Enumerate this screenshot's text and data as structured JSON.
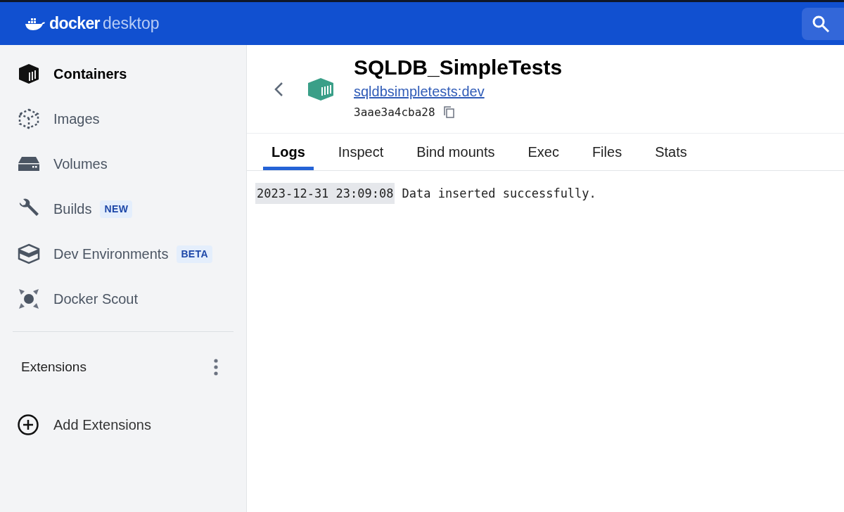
{
  "header": {
    "logo_primary": "docker",
    "logo_secondary": "desktop"
  },
  "sidebar": {
    "items": [
      {
        "label": "Containers",
        "selected": true
      },
      {
        "label": "Images",
        "selected": false
      },
      {
        "label": "Volumes",
        "selected": false
      },
      {
        "label": "Builds",
        "selected": false,
        "badge": "NEW"
      },
      {
        "label": "Dev Environments",
        "selected": false,
        "badge": "BETA"
      },
      {
        "label": "Docker Scout",
        "selected": false
      }
    ],
    "extensions_heading": "Extensions",
    "add_extensions": "Add Extensions"
  },
  "container": {
    "name": "SQLDB_SimpleTests",
    "image_link": "sqldbsimpletests:dev",
    "id": "3aae3a4cba28"
  },
  "tabs": [
    {
      "label": "Logs",
      "selected": true
    },
    {
      "label": "Inspect",
      "selected": false
    },
    {
      "label": "Bind mounts",
      "selected": false
    },
    {
      "label": "Exec",
      "selected": false
    },
    {
      "label": "Files",
      "selected": false
    },
    {
      "label": "Stats",
      "selected": false
    }
  ],
  "logs": [
    {
      "timestamp": "2023-12-31 23:09:08",
      "message": "Data inserted successfully."
    }
  ]
}
